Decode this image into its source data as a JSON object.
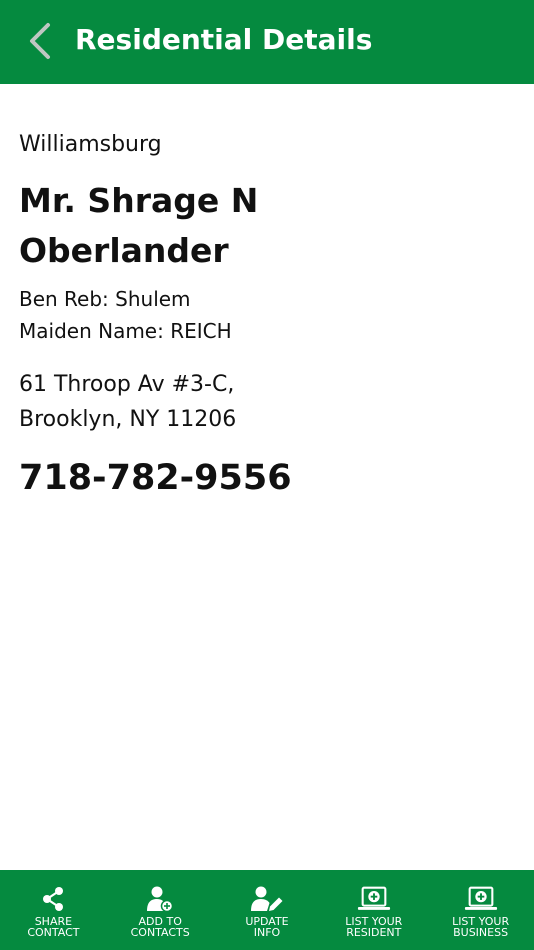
{
  "header": {
    "title": "Residential Details",
    "background_color": "#058a3f",
    "back_icon": "chevron-left-icon"
  },
  "details": {
    "neighborhood": "Williamsburg",
    "name": "Mr. Shrage N Oberlander",
    "ben_reb": "Ben Reb: Shulem",
    "maiden_name": "Maiden Name: REICH",
    "address_line_1": "61 Throop Av #3-C,",
    "address_line_2": "Brooklyn, NY 11206",
    "phone": "718-782-9556"
  },
  "bottom_nav": {
    "items": [
      {
        "line1": "SHARE",
        "line2": "CONTACT",
        "icon": "share-icon"
      },
      {
        "line1": "ADD TO",
        "line2": "CONTACTS",
        "icon": "add-person-icon"
      },
      {
        "line1": "UPDATE",
        "line2": "INFO",
        "icon": "edit-person-icon"
      },
      {
        "line1": "LIST YOUR",
        "line2": "RESIDENT",
        "icon": "laptop-plus-icon"
      },
      {
        "line1": "LIST YOUR",
        "line2": "BUSINESS",
        "icon": "laptop-plus-icon"
      }
    ]
  }
}
